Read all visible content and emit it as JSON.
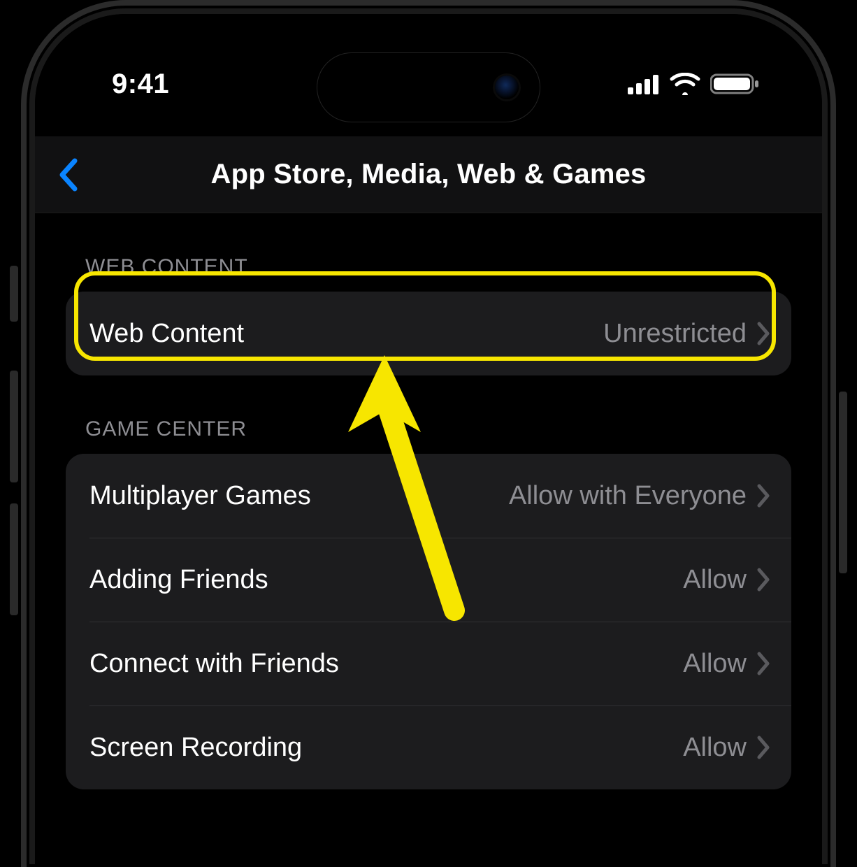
{
  "status": {
    "time": "9:41"
  },
  "nav": {
    "title": "App Store, Media, Web & Games"
  },
  "sections": {
    "web_content": {
      "header": "WEB CONTENT",
      "row": {
        "label": "Web Content",
        "value": "Unrestricted"
      }
    },
    "game_center": {
      "header": "GAME CENTER",
      "rows": [
        {
          "label": "Multiplayer Games",
          "value": "Allow with Everyone"
        },
        {
          "label": "Adding Friends",
          "value": "Allow"
        },
        {
          "label": "Connect with Friends",
          "value": "Allow"
        },
        {
          "label": "Screen Recording",
          "value": "Allow"
        }
      ]
    }
  },
  "annotation": {
    "highlight_target": "web-content-row"
  }
}
